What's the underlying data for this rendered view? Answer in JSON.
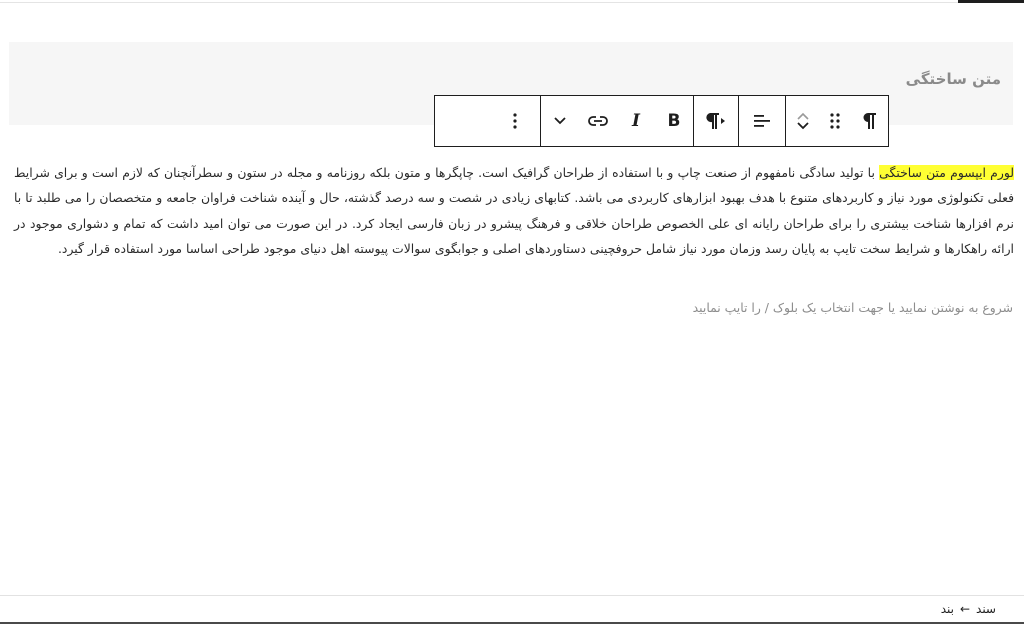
{
  "title_block": {
    "title": "متن ساختگی"
  },
  "toolbar": {
    "icons": [
      "paragraph-icon",
      "drag-handle-icon",
      "move-up-down-icon",
      "align-icon",
      "text-direction-icon",
      "bold-icon",
      "italic-icon",
      "link-icon",
      "chevron-down-icon",
      "more-options-icon"
    ]
  },
  "paragraph": {
    "highlight": "لورم ایپسوم متن ساختگی",
    "text": " با تولید سادگی نامفهوم از صنعت چاپ و با استفاده از طراحان گرافیک است. چاپگرها و متون بلکه روزنامه و مجله در ستون و سطرآنچنان که لازم است و برای شرایط فعلی تکنولوژی مورد نیاز و کاربردهای متنوع با هدف بهبود ابزارهای کاربردی می باشد. کتابهای زیادی در شصت و سه درصد گذشته، حال و آینده شناخت فراوان جامعه و متخصصان را می طلبد تا با نرم افزارها شناخت بیشتری را برای طراحان رایانه ای علی الخصوص طراحان خلاقی و فرهنگ پیشرو در زبان فارسی ایجاد کرد. در این صورت می توان امید داشت که تمام و دشواری موجود در ارائه راهکارها و شرایط سخت تایپ به پایان رسد وزمان مورد نیاز شامل حروفچینی دستاوردهای اصلی و جوابگوی سوالات پیوسته اهل دنیای موجود طراحی اساسا مورد استفاده قرار گیرد."
  },
  "placeholder": {
    "text": "شروع به نوشتن نمایید یا جهت انتخاب یک بلوک / را تایپ نمایید"
  },
  "footer": {
    "crumb_doc": "سند",
    "crumb_arrow": "←",
    "crumb_block": "بند"
  }
}
